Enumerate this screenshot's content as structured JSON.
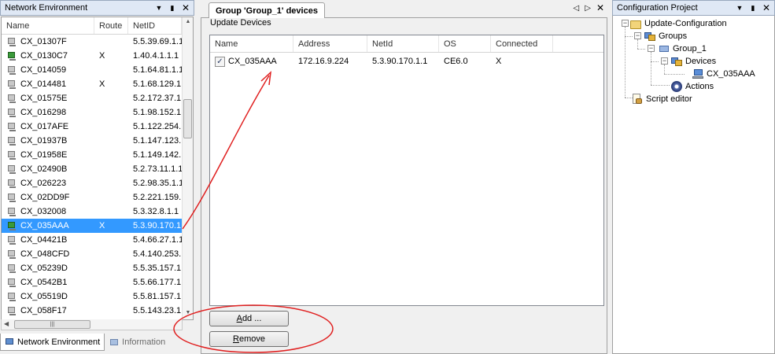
{
  "left_panel": {
    "title": "Network Environment",
    "pin_icon": "pin-icon",
    "columns": [
      "Name",
      "Route",
      "NetID"
    ],
    "rows": [
      {
        "name": "CX_01307F",
        "route": "",
        "netid": "5.5.39.69.1.1",
        "icon": "device-icon"
      },
      {
        "name": "CX_0130C7",
        "route": "X",
        "netid": "1.40.4.1.1.1",
        "icon": "route-device-icon"
      },
      {
        "name": "CX_014059",
        "route": "",
        "netid": "5.1.64.81.1.1",
        "icon": "device-icon"
      },
      {
        "name": "CX_014481",
        "route": "X",
        "netid": "5.1.68.129.1.",
        "icon": "device-icon"
      },
      {
        "name": "CX_01575E",
        "route": "",
        "netid": "5.2.172.37.1.",
        "icon": "device-icon"
      },
      {
        "name": "CX_016298",
        "route": "",
        "netid": "5.1.98.152.1.",
        "icon": "device-icon"
      },
      {
        "name": "CX_017AFE",
        "route": "",
        "netid": "5.1.122.254.",
        "icon": "device-icon"
      },
      {
        "name": "CX_01937B",
        "route": "",
        "netid": "5.1.147.123.",
        "icon": "device-icon"
      },
      {
        "name": "CX_01958E",
        "route": "",
        "netid": "5.1.149.142.",
        "icon": "device-icon"
      },
      {
        "name": "CX_02490B",
        "route": "",
        "netid": "5.2.73.11.1.1",
        "icon": "device-icon"
      },
      {
        "name": "CX_026223",
        "route": "",
        "netid": "5.2.98.35.1.1",
        "icon": "device-icon"
      },
      {
        "name": "CX_02DD9F",
        "route": "",
        "netid": "5.2.221.159.",
        "icon": "device-icon"
      },
      {
        "name": "CX_032008",
        "route": "",
        "netid": "5.3.32.8.1.1",
        "icon": "device-icon"
      },
      {
        "name": "CX_035AAA",
        "route": "X",
        "netid": "5.3.90.170.1",
        "icon": "route-device-icon",
        "selected": true
      },
      {
        "name": "CX_04421B",
        "route": "",
        "netid": "5.4.66.27.1.1",
        "icon": "device-icon"
      },
      {
        "name": "CX_048CFD",
        "route": "",
        "netid": "5.4.140.253.",
        "icon": "device-icon"
      },
      {
        "name": "CX_05239D",
        "route": "",
        "netid": "5.5.35.157.1.",
        "icon": "device-icon"
      },
      {
        "name": "CX_0542B1",
        "route": "",
        "netid": "5.5.66.177.1.",
        "icon": "device-icon"
      },
      {
        "name": "CX_05519D",
        "route": "",
        "netid": "5.5.81.157.1.",
        "icon": "device-icon"
      },
      {
        "name": "CX_058F17",
        "route": "",
        "netid": "5.5.143.23.1.",
        "icon": "device-icon"
      }
    ],
    "tabs": [
      {
        "label": "Network Environment",
        "active": true
      },
      {
        "label": "Information",
        "active": false
      }
    ]
  },
  "center_panel": {
    "tab_title": "Group 'Group_1' devices",
    "group_label": "Update Devices",
    "columns": [
      "Name",
      "Address",
      "NetId",
      "OS",
      "Connected"
    ],
    "devices": [
      {
        "checked": true,
        "name": "CX_035AAA",
        "address": "172.16.9.224",
        "netid": "5.3.90.170.1.1",
        "os": "CE6.0",
        "connected": "X"
      }
    ],
    "add_button": {
      "mnemonic": "A",
      "rest": "dd ..."
    },
    "remove_button": {
      "mnemonic": "R",
      "rest": "emove"
    }
  },
  "right_panel": {
    "title": "Configuration Project",
    "tree": {
      "root": "Update-Configuration",
      "groups": "Groups",
      "group": "Group_1",
      "devices": "Devices",
      "device": "CX_035AAA",
      "actions": "Actions",
      "script_editor": "Script editor"
    }
  },
  "colors": {
    "selection": "#3399ff",
    "annotation": "#e02020",
    "title_bar": "#dfe8f5"
  }
}
